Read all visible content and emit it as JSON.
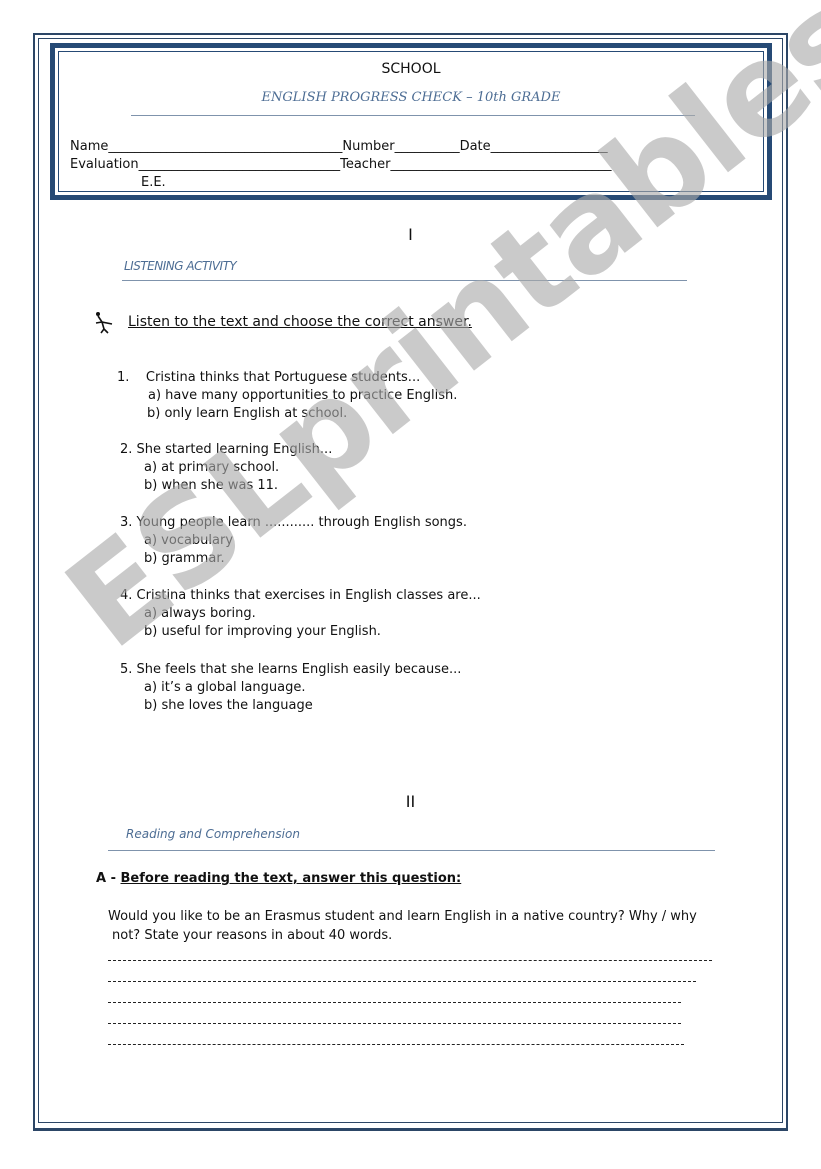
{
  "header": {
    "school": "SCHOOL",
    "title": "ENGLISH PROGRESS CHECK – 10th GRADE",
    "fields": {
      "row1": "Name____________________________________Number__________Date__________________",
      "row2": "Evaluation_______________________________Teacher__________________________________",
      "row3": "E.E."
    }
  },
  "section1": {
    "number": "I",
    "heading": "LISTENING ACTIVITY",
    "icon": "running-figure-icon",
    "instruction": "Listen to the text and choose the correct answer.",
    "questions": [
      {
        "stem": "1.    Cristina thinks that Portuguese students...",
        "options": [
          "a) have many opportunities to practice English.",
          "b) only learn English at school."
        ]
      },
      {
        "stem": "2. She started learning English...",
        "options": [
          "a) at primary school.",
          "b) when she was 11."
        ]
      },
      {
        "stem": "3. Young people learn ............ through English songs.",
        "options": [
          "a) vocabulary",
          "b) grammar."
        ]
      },
      {
        "stem": "4. Cristina thinks that exercises in English classes are...",
        "options": [
          "a) always boring.",
          "b) useful for improving your English."
        ]
      },
      {
        "stem": "5. She feels that she learns English easily because...",
        "options": [
          "a) it’s a global language.",
          "b) she loves the language"
        ]
      }
    ]
  },
  "section2": {
    "number": "II",
    "heading": "Reading and Comprehension",
    "part_a": {
      "label": "A - ",
      "instruction": "Before reading the text, answer this question:",
      "question_line1": "Would you like to be an Erasmus student and learn English in a native country?  Why / why",
      "question_line2": "not? State your reasons in about 40 words.",
      "answer_lines": 5
    }
  },
  "watermark": "ESLprintables.com"
}
